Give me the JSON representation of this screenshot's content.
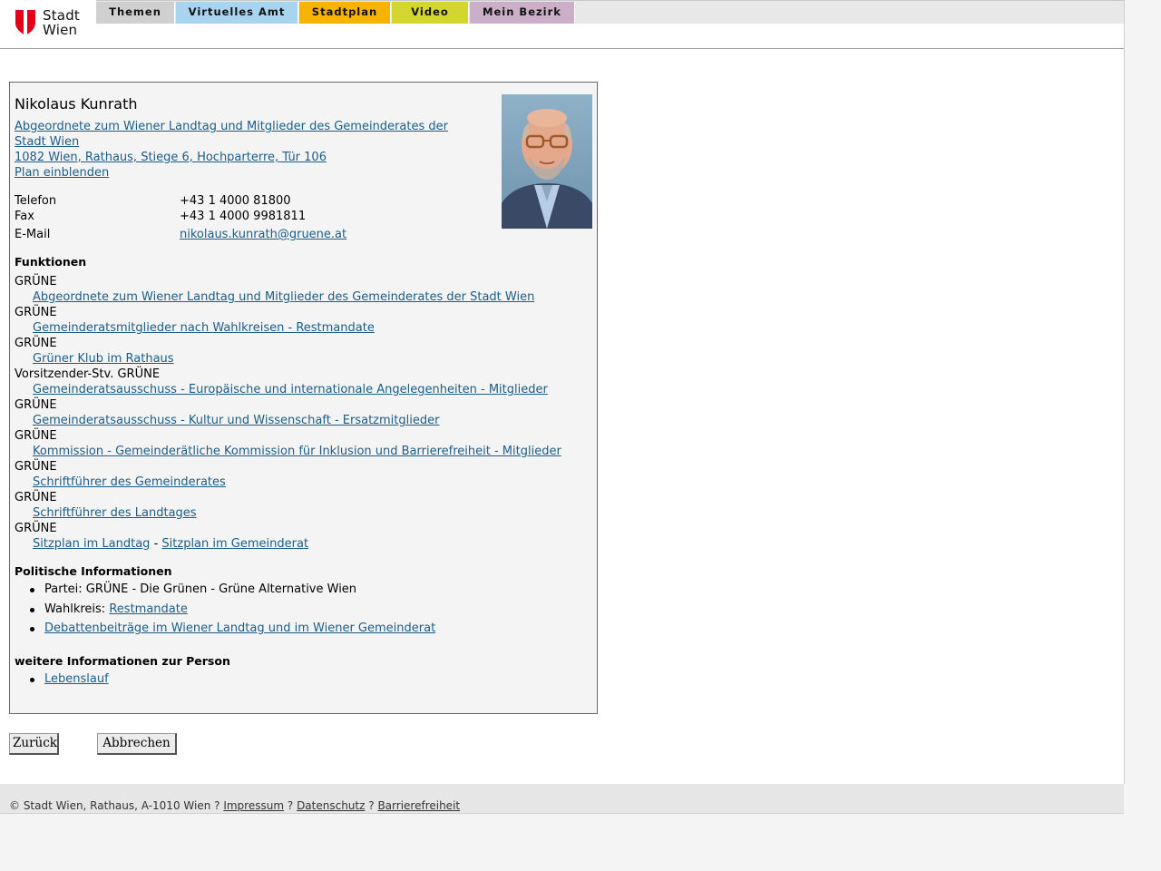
{
  "header": {
    "logo_text_1": "Stadt",
    "logo_text_2": "Wien",
    "tabs": [
      {
        "label": "Themen",
        "color": "#d0d0d0"
      },
      {
        "label": "Virtuelles Amt",
        "color": "#a9d4f0"
      },
      {
        "label": "Stadtplan",
        "color": "#f7b300"
      },
      {
        "label": "Video",
        "color": "#d4d630"
      },
      {
        "label": "Mein Bezirk",
        "color": "#cbaec7"
      }
    ]
  },
  "person": {
    "name": "Nikolaus Kunrath",
    "org_line_1": "Abgeordnete zum Wiener Landtag und Mitglieder des Gemeinderates der",
    "org_line_2": "Stadt Wien",
    "address": "1082 Wien, Rathaus, Stiege 6, Hochparterre, Tür 106",
    "map_link": "Plan einblenden",
    "contacts": [
      {
        "label": "Telefon",
        "value": "+43 1 4000 81800"
      },
      {
        "label": "Fax",
        "value": "+43 1 4000 9981811"
      },
      {
        "label": "E-Mail",
        "value": "nikolaus.kunrath@gruene.at"
      }
    ]
  },
  "functions": {
    "heading": "Funktionen",
    "items": [
      {
        "role": "GRÜNE",
        "link": "Abgeordnete zum Wiener Landtag und Mitglieder des Gemeinderates der Stadt Wien"
      },
      {
        "role": "GRÜNE",
        "link": "Gemeinderatsmitglieder nach Wahlkreisen - Restmandate"
      },
      {
        "role": "GRÜNE",
        "link": "Grüner Klub im Rathaus"
      },
      {
        "role": "Vorsitzender-Stv. GRÜNE",
        "link": "Gemeinderatsausschuss - Europäische und internationale Angelegenheiten - Mitglieder"
      },
      {
        "role": "GRÜNE",
        "link": "Gemeinderatsausschuss - Kultur und Wissenschaft - Ersatzmitglieder"
      },
      {
        "role": "GRÜNE",
        "link": "Kommission - Gemeinderätliche Kommission für Inklusion und Barrierefreiheit - Mitglieder"
      },
      {
        "role": "GRÜNE",
        "link": "Schriftführer des Gemeinderates"
      },
      {
        "role": "GRÜNE",
        "link": "Schriftführer des Landtages"
      }
    ],
    "last_role": "GRÜNE",
    "seat_link_1": "Sitzplan im Landtag",
    "seat_sep": "-",
    "seat_link_2": "Sitzplan im Gemeinderat"
  },
  "political": {
    "heading": "Politische Informationen",
    "party": "Partei: GRÜNE - Die Grünen - Grüne Alternative Wien",
    "district_label": "Wahlkreis:",
    "district_link": "Restmandate",
    "debates_link": "Debattenbeiträge im Wiener Landtag und im Wiener Gemeinderat"
  },
  "more": {
    "heading": "weitere Informationen zur Person",
    "cv_link": "Lebenslauf"
  },
  "buttons": {
    "back": "Zurück",
    "cancel": "Abbrechen"
  },
  "footer": {
    "copyright": "© Stadt Wien, Rathaus, A-1010 Wien ?",
    "impressum": "Impressum",
    "sep1": "?",
    "datenschutz": "Datenschutz",
    "sep2": "?",
    "barrierefreiheit": "Barrierefreiheit"
  }
}
